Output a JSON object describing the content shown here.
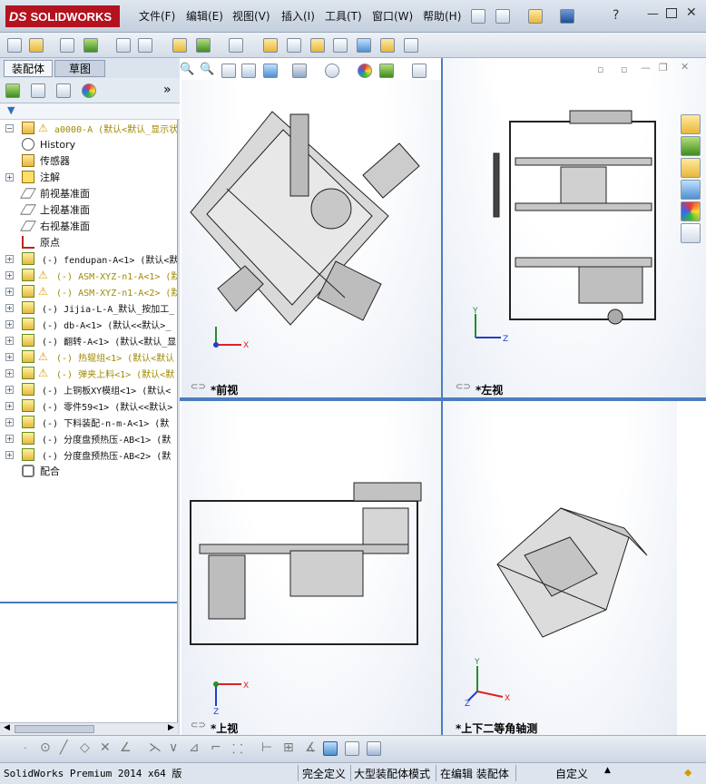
{
  "app": {
    "logo_brand": "DS",
    "logo_name": "SOLIDWORKS"
  },
  "menu": [
    "文件(F)",
    "编辑(E)",
    "视图(V)",
    "插入(I)",
    "工具(T)",
    "窗口(W)",
    "帮助(H)"
  ],
  "manager_tabs": {
    "assembly": "装配体",
    "sketch": "草图"
  },
  "tree": {
    "root": "a0000-A  (默认<默认_显示状",
    "items": [
      {
        "label": "History",
        "type": "history"
      },
      {
        "label": "传感器",
        "type": "sensor"
      },
      {
        "label": "注解",
        "type": "annotation"
      },
      {
        "label": "前视基准面",
        "type": "plane"
      },
      {
        "label": "上视基准面",
        "type": "plane"
      },
      {
        "label": "右视基准面",
        "type": "plane"
      },
      {
        "label": "原点",
        "type": "origin"
      },
      {
        "label": "(-) fendupan-A<1> (默认<默",
        "type": "part"
      },
      {
        "label": "(-) ASM-XYZ-n1-A<1> (默",
        "type": "part",
        "warn": true
      },
      {
        "label": "(-) ASM-XYZ-n1-A<2> (默",
        "type": "part",
        "warn": true
      },
      {
        "label": "(-) Jijia-L-A_默认_按加工_",
        "type": "part"
      },
      {
        "label": "(-) db-A<1> (默认<<默认>_",
        "type": "part"
      },
      {
        "label": "(-) 翻转-A<1> (默认<默认_显",
        "type": "part"
      },
      {
        "label": "(-) 热辊组<1> (默认<默认",
        "type": "part",
        "warn": true
      },
      {
        "label": "(-) 弹夹上料<1> (默认<默",
        "type": "part",
        "warn": true
      },
      {
        "label": "(-) 上铜板XY模组<1> (默认<",
        "type": "part"
      },
      {
        "label": "(-) 零件59<1> (默认<<默认>",
        "type": "part"
      },
      {
        "label": "(-) 下料装配-n-m-A<1> (默",
        "type": "part"
      },
      {
        "label": "(-) 分度盘预热压-AB<1> (默",
        "type": "part"
      },
      {
        "label": "(-) 分度盘预热压-AB<2> (默",
        "type": "part"
      },
      {
        "label": "配合",
        "type": "mates"
      }
    ]
  },
  "viewports": {
    "front": "*前视",
    "left": "*左视",
    "top": "*上视",
    "iso": "*上下二等角轴测"
  },
  "axes": {
    "x": "X",
    "y": "Y",
    "z": "Z"
  },
  "status": {
    "product": "SolidWorks Premium 2014 x64 版",
    "definition": "完全定义",
    "mode": "大型装配体模式",
    "editing": "在编辑 装配体",
    "custom": "自定义"
  }
}
